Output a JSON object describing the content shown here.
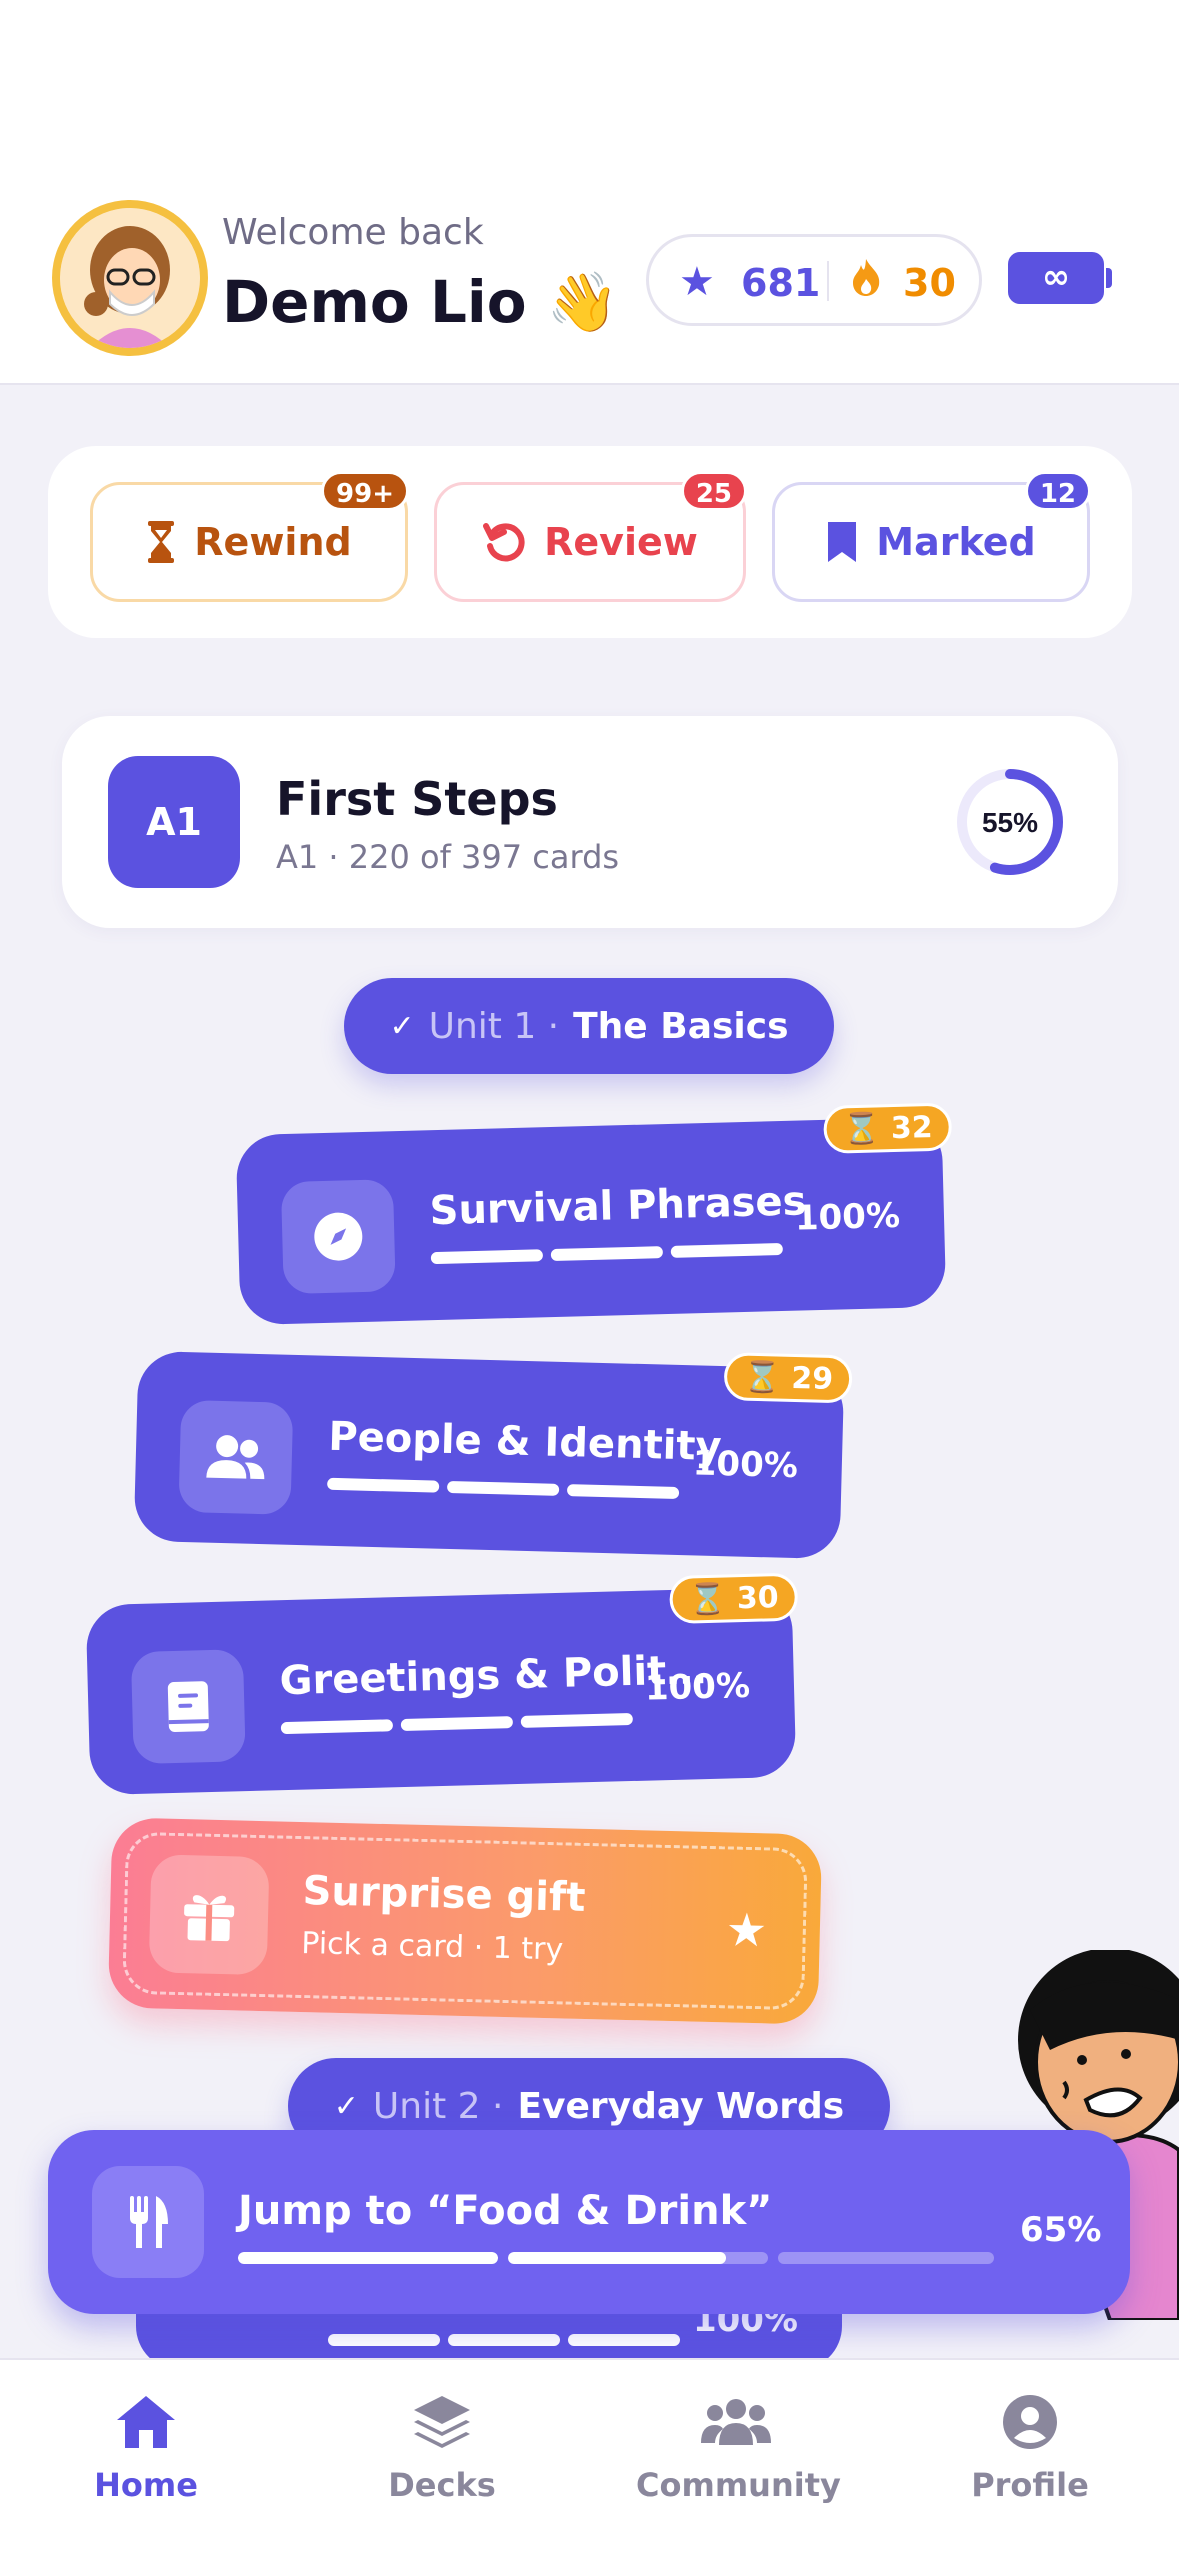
{
  "header": {
    "welcome": "Welcome back",
    "username": "Demo Lio",
    "wave_emoji": "👋",
    "stars": "681",
    "streak": "30",
    "battery_label": "∞"
  },
  "quick_actions": [
    {
      "label": "Rewind",
      "badge": "99+",
      "icon": "hourglass-icon"
    },
    {
      "label": "Review",
      "badge": "25",
      "icon": "undo-icon"
    },
    {
      "label": "Marked",
      "badge": "12",
      "icon": "bookmark-icon"
    }
  ],
  "course": {
    "level": "A1",
    "title": "First Steps",
    "subtitle": "A1 · 220 of 397 cards",
    "progress_label": "55%",
    "progress": 0.55
  },
  "units": [
    {
      "prefix": "Unit 1 ·",
      "title": "The Basics"
    },
    {
      "prefix": "Unit 2 ·",
      "title": "Everyday Words"
    }
  ],
  "lessons": [
    {
      "title": "Survival Phrases",
      "pct": "100%",
      "tag": "32",
      "icon": "compass-icon"
    },
    {
      "title": "People & Identity",
      "pct": "100%",
      "tag": "29",
      "icon": "people-icon"
    },
    {
      "title": "Greetings & Polit…",
      "pct": "100%",
      "tag": "30",
      "icon": "book-icon"
    },
    {
      "title": "",
      "pct": "100%",
      "icon": ""
    }
  ],
  "gift": {
    "title": "Surprise gift",
    "subtitle": "Pick a card · 1 try"
  },
  "jump": {
    "title": "Jump to “Food & Drink”",
    "pct": "65%",
    "progress": 0.65
  },
  "tabs": [
    {
      "label": "Home",
      "icon": "home-icon",
      "active": true
    },
    {
      "label": "Decks",
      "icon": "layers-icon",
      "active": false
    },
    {
      "label": "Community",
      "icon": "community-icon",
      "active": false
    },
    {
      "label": "Profile",
      "icon": "profile-icon",
      "active": false
    }
  ],
  "colors": {
    "primary": "#5b52e0",
    "accent_orange": "#f5a623",
    "review_red": "#e8434e",
    "rewind_brown": "#b8530f",
    "background": "#f2f1f8"
  }
}
